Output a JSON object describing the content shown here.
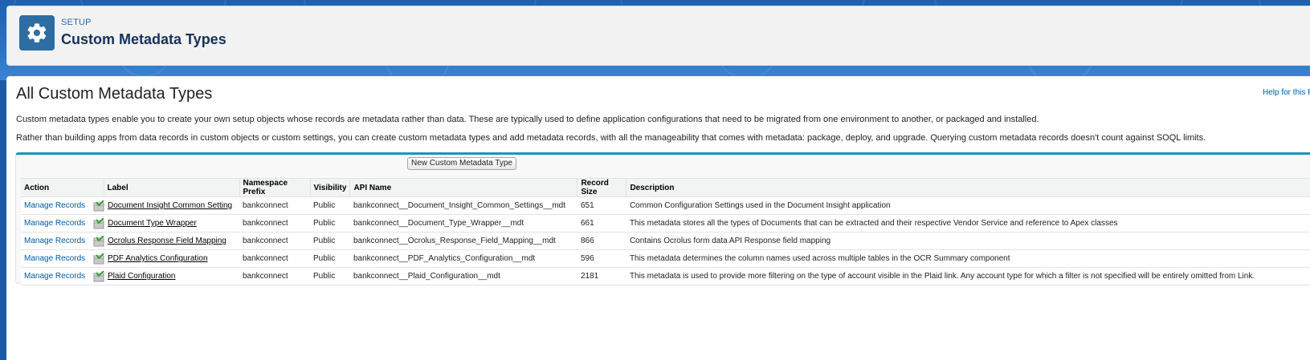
{
  "header": {
    "eyebrow": "SETUP",
    "title": "Custom Metadata Types",
    "icon": "gear-icon"
  },
  "page": {
    "title": "All Custom Metadata Types",
    "help_link": "Help for this P",
    "intro_1": "Custom metadata types enable you to create your own setup objects whose records are metadata rather than data. These are typically used to define application configurations that need to be migrated from one environment to another, or packaged and installed.",
    "intro_2": "Rather than building apps from data records in custom objects or custom settings, you can create custom metadata types and add metadata records, with all the manageability that comes with metadata: package, deploy, and upgrade. Querying custom metadata records doesn't count against SOQL limits."
  },
  "list": {
    "new_button": "New Custom Metadata Type",
    "columns": [
      "Action",
      "Label",
      "Namespace Prefix",
      "Visibility",
      "API Name",
      "Record Size",
      "Description"
    ],
    "rows": [
      {
        "action": "Manage Records",
        "label": "Document Insight Common Setting",
        "namespace": "bankconnect",
        "visibility": "Public",
        "api_name": "bankconnect__Document_Insight_Common_Settings__mdt",
        "record_size": "651",
        "description": "Common Configuration Settings used in the Document Insight application"
      },
      {
        "action": "Manage Records",
        "label": "Document Type Wrapper",
        "namespace": "bankconnect",
        "visibility": "Public",
        "api_name": "bankconnect__Document_Type_Wrapper__mdt",
        "record_size": "661",
        "description": "This metadata stores all the types of Documents that can be extracted and their respective Vendor Service and reference to Apex classes"
      },
      {
        "action": "Manage Records",
        "label": "Ocrolus Response Field Mapping",
        "namespace": "bankconnect",
        "visibility": "Public",
        "api_name": "bankconnect__Ocrolus_Response_Field_Mapping__mdt",
        "record_size": "866",
        "description": "Contains Ocrolus form data API Response field mapping"
      },
      {
        "action": "Manage Records",
        "label": "PDF Analytics Configuration",
        "namespace": "bankconnect",
        "visibility": "Public",
        "api_name": "bankconnect__PDF_Analytics_Configuration__mdt",
        "record_size": "596",
        "description": "This metadata determines the column names used across multiple tables in the OCR Summary component"
      },
      {
        "action": "Manage Records",
        "label": "Plaid Configuration",
        "namespace": "bankconnect",
        "visibility": "Public",
        "api_name": "bankconnect__Plaid_Configuration__mdt",
        "record_size": "2181",
        "description": "This metadata is used to provide more filtering on the type of account visible in the Plaid link. Any account type for which a filter is not specified will be entirely omitted from Link."
      }
    ]
  }
}
